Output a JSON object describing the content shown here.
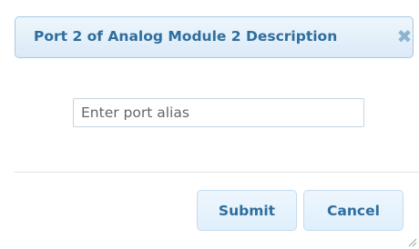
{
  "dialog": {
    "title": "Port 2 of Analog Module 2 Description",
    "close_icon": "close-icon"
  },
  "form": {
    "alias_value": "",
    "alias_placeholder": "Enter port alias"
  },
  "buttons": {
    "submit_label": "Submit",
    "cancel_label": "Cancel"
  },
  "colors": {
    "title_text": "#2e6e9e",
    "title_bg": "#dbeaf7",
    "border": "#a6c9e2"
  }
}
